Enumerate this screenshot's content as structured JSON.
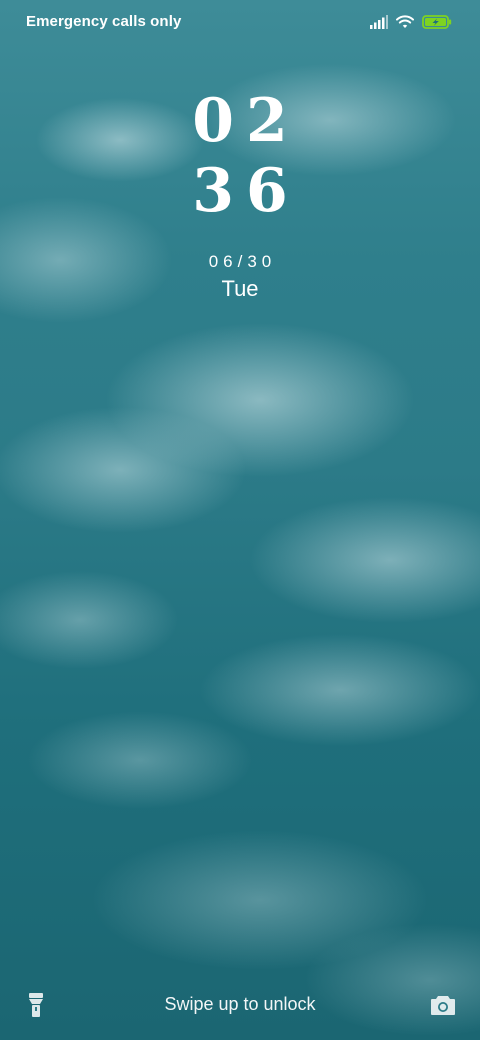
{
  "status_bar": {
    "carrier_text": "Emergency calls only",
    "icons": [
      "signal-icon",
      "wifi-icon",
      "battery-charging-icon"
    ],
    "battery_color": "#7ed321"
  },
  "lock_screen": {
    "hour": "02",
    "minute": "36",
    "date": "06/30",
    "weekday": "Tue"
  },
  "bottom": {
    "unlock_hint": "Swipe up to unlock",
    "left_shortcut": "flashlight-icon",
    "right_shortcut": "camera-icon"
  }
}
